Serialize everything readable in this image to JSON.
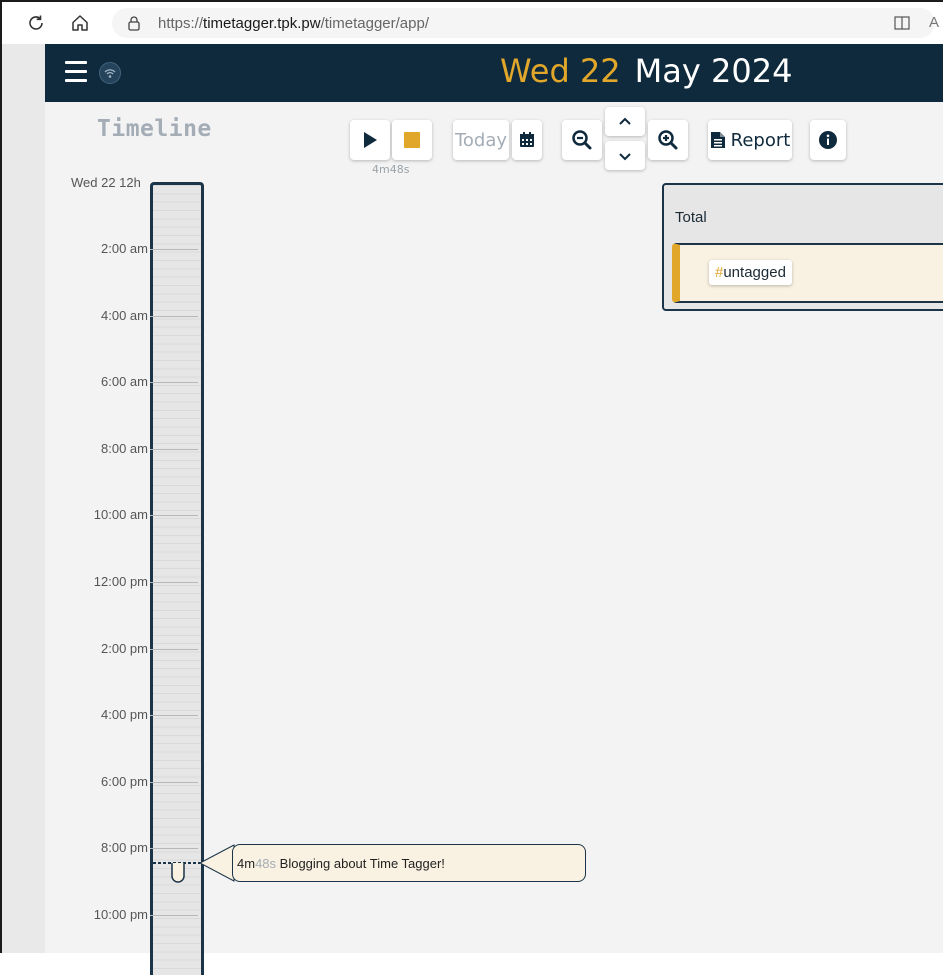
{
  "browser": {
    "url_prefix": "https://",
    "url_host": "timetagger.tpk.pw",
    "url_path": "/timetagger/app/",
    "more_letter": "A"
  },
  "header": {
    "day": "Wed 22",
    "month_year": "May 2024"
  },
  "toolbar": {
    "timeline_title": "Timeline",
    "today_label": "Today",
    "report_label": "Report",
    "elapsed": "4m48s"
  },
  "timeline": {
    "date_label": "Wed 22  12h",
    "ticks": [
      "2:00 am",
      "4:00 am",
      "6:00 am",
      "8:00 am",
      "10:00 am",
      "12:00 pm",
      "2:00 pm",
      "4:00 pm",
      "6:00 pm",
      "8:00 pm",
      "10:00 pm"
    ]
  },
  "record": {
    "duration_main": "4m",
    "duration_seconds": "48s",
    "description": "Blogging about Time Tagger!"
  },
  "overview": {
    "total_label": "Total",
    "tag_hash": "#",
    "tag_name": "untagged"
  },
  "colors": {
    "navy": "#0f2a3d",
    "accent": "#e1a72b",
    "record_bg": "#f9f1e1"
  }
}
